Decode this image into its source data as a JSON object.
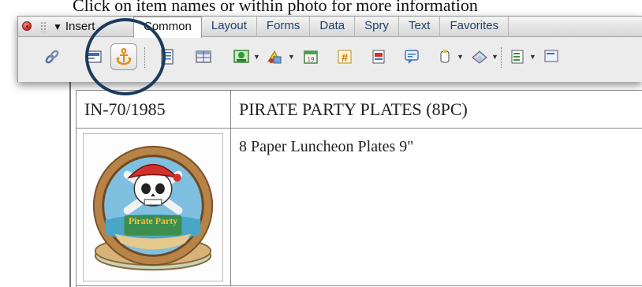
{
  "page": {
    "header_text": "Click on item names or within photo for more information",
    "table": {
      "item_number": "IN-70/1985",
      "item_name": "PIRATE PARTY PLATES (8PC)",
      "description": "8 Paper Luncheon Plates 9\"",
      "photo_alt_text": "Pirate Party"
    }
  },
  "insert_panel": {
    "panel_label": "Insert",
    "tabs": [
      "Common",
      "Layout",
      "Forms",
      "Data",
      "Spry",
      "Text",
      "Favorites"
    ],
    "active_tab": "Common",
    "toolbar_icons": [
      "hyperlink-icon",
      "email-link-icon",
      "named-anchor-icon",
      "horizontal-rule-icon",
      "table-icon",
      "image-icon",
      "media-icon",
      "date-icon",
      "server-side-include-icon",
      "comment-icon",
      "head-icon",
      "script-icon",
      "templates-icon",
      "tag-chooser-icon"
    ],
    "colors": {
      "highlight_circle": "#1b3a5c",
      "active_tab_bg": "#ffffff",
      "tab_text": "#1f3f6c",
      "close_button": "#d8312a"
    }
  }
}
